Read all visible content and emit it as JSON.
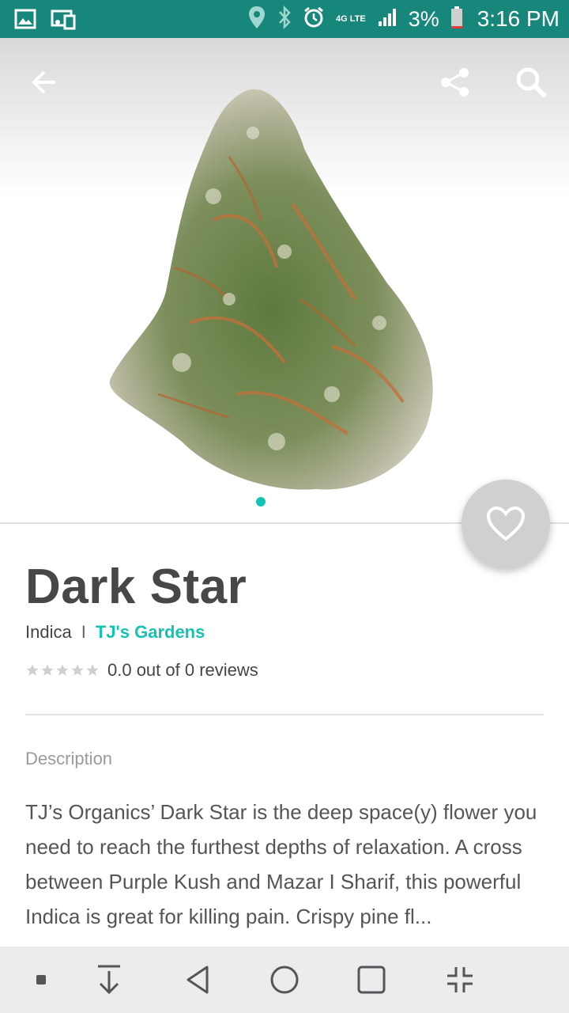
{
  "status_bar": {
    "battery": "3%",
    "time": "3:16 PM",
    "network": "4G LTE",
    "icons": [
      "image-icon",
      "cast-icon",
      "location-icon",
      "bluetooth-icon",
      "alarm-icon",
      "network-icon",
      "signal-icon",
      "battery-icon"
    ]
  },
  "product": {
    "name": "Dark Star",
    "type": "Indica",
    "separator": "I",
    "brand": "TJ's Gardens",
    "rating": 0,
    "rating_text": "0.0 out of 0 reviews",
    "description_label": "Description",
    "description": "TJ’s Organics’ Dark Star is the deep space(y) flower you need to reach the furthest depths of relaxation. A cross between Purple Kush and Mazar I Sharif, this powerful Indica is great for killing pain. Crispy pine fl..."
  },
  "carousel": {
    "page": 1,
    "total": 1
  },
  "colors": {
    "status_bar": "#16877a",
    "accent": "#14c3b3",
    "fab": "#d0d0d0"
  },
  "navbar_icons": [
    "square-small-icon",
    "download-icon",
    "back-icon",
    "home-icon",
    "recents-icon",
    "collapse-icon"
  ]
}
